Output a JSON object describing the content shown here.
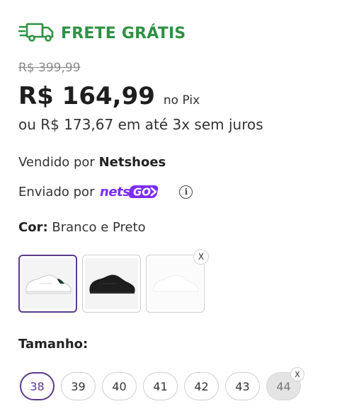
{
  "shipping": {
    "label": "FRETE GRÁTIS",
    "icon": "fast-truck-icon",
    "color": "#2f9143"
  },
  "pricing": {
    "old_price": "R$ 399,99",
    "price": "R$ 164,99",
    "pix_label": "no Pix",
    "installments": "ou R$ 173,67 em até 3x sem juros"
  },
  "seller": {
    "prefix": "Vendido por",
    "name": "Netshoes"
  },
  "shipped_by": {
    "prefix": "Enviado por",
    "brand": "netsGO",
    "brand_color": "#7b2cff",
    "info_icon": "info-icon"
  },
  "color": {
    "label": "Cor:",
    "selected_value": "Branco e Preto",
    "options": [
      {
        "name": "Branco e Preto",
        "selected": true,
        "available": true
      },
      {
        "name": "Preto",
        "selected": false,
        "available": true
      },
      {
        "name": "Branco",
        "selected": false,
        "available": false,
        "badge": "x"
      }
    ]
  },
  "size": {
    "label": "Tamanho:",
    "options": [
      {
        "value": "38",
        "selected": true,
        "available": true
      },
      {
        "value": "39",
        "selected": false,
        "available": true
      },
      {
        "value": "40",
        "selected": false,
        "available": true
      },
      {
        "value": "41",
        "selected": false,
        "available": true
      },
      {
        "value": "42",
        "selected": false,
        "available": true
      },
      {
        "value": "43",
        "selected": false,
        "available": true
      },
      {
        "value": "44",
        "selected": false,
        "available": false,
        "badge": "x"
      }
    ]
  },
  "accent_color": "#5a3b8c"
}
